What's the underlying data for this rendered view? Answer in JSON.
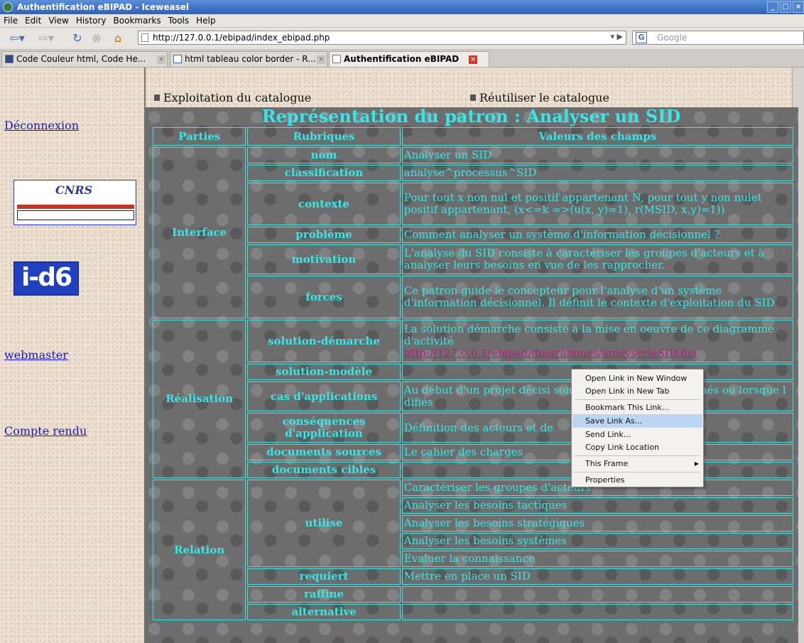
{
  "window": {
    "title": "Authentification eBIPAD - Iceweasel"
  },
  "menu": [
    "File",
    "Edit",
    "View",
    "History",
    "Bookmarks",
    "Tools",
    "Help"
  ],
  "nav": {
    "url": "http://127.0.0.1/ebipad/index_ebipad.php",
    "search_placeholder": "Google"
  },
  "tabs": [
    {
      "label": "Code Couleur html, Code He..."
    },
    {
      "label": "html tableau color border - R..."
    },
    {
      "label": "Authentification eBIPAD"
    }
  ],
  "left": {
    "deconnexion": "Déconnexion",
    "logo_cnrs": "CNRS",
    "logo_id6": "i-d6",
    "webmaster": "webmaster",
    "compte_rendu": "Compte rendu"
  },
  "top": {
    "exploitation": "Exploitation du catalogue",
    "reutiliser": "Réutiliser le catalogue"
  },
  "page": {
    "title": "Représentation du patron : Analyser un SID",
    "headers": [
      "Parties",
      "Rubriques",
      "Valeurs des champs"
    ],
    "parts": [
      "Interface",
      "Réalisation",
      "Relation"
    ],
    "rubriques": [
      "nom",
      "classification",
      "contexte",
      "problème",
      "motivation",
      "forces",
      "solution-démarche",
      "solution-modèle",
      "cas d'applications",
      "conséquences d'application",
      "documents sources",
      "documents cibles",
      "utilise",
      "requiert",
      "raffine",
      "alternative"
    ],
    "values": {
      "nom": "Analyser un SID",
      "classification": "analyse^processus^SID",
      "contexte": "Pour tout x non nul et positif appartenant N, pour tout y non nulet positif appartenant, (x<=k =>(u(x, y)=1), r(MSID, x,y)=1))",
      "probleme": "Comment analyser un système d'information décisionnel ?",
      "motivation": "L'analyse du SID consiste à caractériser les groupes d'acteurs et à analyser leurs besoins en vue de les rapprocher.",
      "forces": "Ce patron guide le concepteur pour l'analyse d'un système d'information décisionnel. Il définit le contexte d'exploitation du SID",
      "solution_demarche": "La solution démarche consiste à la mise en oeuvre de ce diagramme d'activité",
      "solution_link": "http://127.0.0.1/ebipad/diagrammes/analyserleSID.dia",
      "cas": "Au début d'un projet décisi          soins n'ont pas été rapprochés ou lorsque l          difiés",
      "consequences": "Définition des acteurs et de",
      "docs_sources": "Le cahier des charges",
      "utilise": [
        "Caractériser les groupes d'acteurs",
        "Analyser les besoins tactiques",
        "Analyser les besoins stratégiques",
        "Analyser les besoins systèmes",
        "Evaluer la connaissance"
      ],
      "requiert": "Mettre en place un SID"
    }
  },
  "context_menu": {
    "items": [
      "Open Link in New Window",
      "Open Link in New Tab",
      "Bookmark This Link...",
      "Save Link As...",
      "Send Link...",
      "Copy Link Location",
      "This Frame",
      "Properties"
    ],
    "highlighted": "Save Link As..."
  }
}
